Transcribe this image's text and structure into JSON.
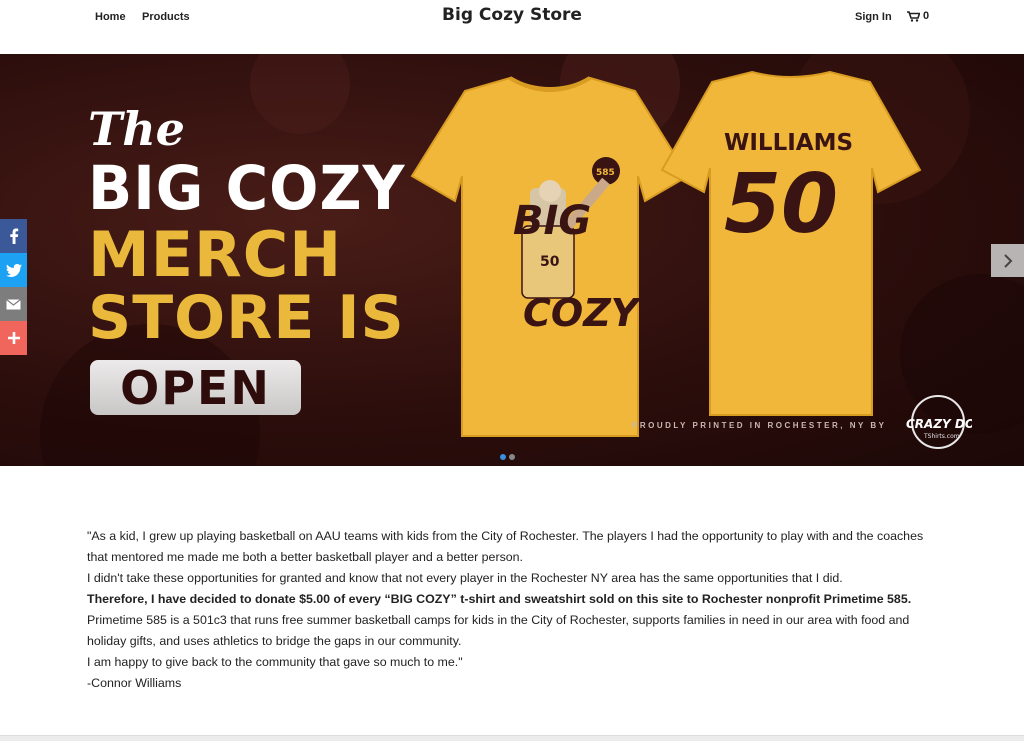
{
  "nav": {
    "home": "Home",
    "products": "Products",
    "site_title": "Big Cozy Store",
    "sign_in": "Sign In",
    "cart_count": "0"
  },
  "hero": {
    "the": "The",
    "line1": "BIG COZY",
    "line2": "MERCH",
    "line3": "STORE IS",
    "open": "OPEN",
    "shirt_front_big": "BIG",
    "shirt_front_cozy": "COZY",
    "shirt_front_num": "50",
    "shirt_front_ball": "585",
    "shirt_back_name": "WILLIAMS",
    "shirt_back_num": "50",
    "printed_note": "PROUDLY PRINTED IN ROCHESTER, NY BY",
    "logo_text": "CRAZY DOG",
    "logo_sub": "TShirts.com",
    "shirt_color": "#f1b73a",
    "shirt_ink": "#3a1313",
    "accent": "#eab93b"
  },
  "carousel": {
    "slides": 2,
    "active": 1
  },
  "share": [
    {
      "name": "facebook",
      "color": "#3b5998"
    },
    {
      "name": "twitter",
      "color": "#1da1f2"
    },
    {
      "name": "email",
      "color": "#7d7d7d"
    },
    {
      "name": "more",
      "color": "#f0665c"
    }
  ],
  "content": {
    "p1": "\"As a kid, I grew up playing basketball on AAU teams with kids from the City of Rochester. The players I had the opportunity to play with and the coaches that mentored me made me both a better basketball player and a better person.",
    "p2": "I didn't take these opportunities for granted and know that not every player in the Rochester NY area has the same opportunities that I did.",
    "p3": " Therefore, I have decided to donate $5.00 of every “BIG COZY” t-shirt and sweatshirt sold on this site to Rochester nonprofit Primetime 585.",
    "p4": "Primetime 585 is a 501c3 that runs free summer basketball camps for kids in the City of Rochester, supports families in need in our area with food and holiday gifts, and uses athletics to bridge the gaps in our community.",
    "p5": "I am happy to give back to the community that gave so much to me.\"",
    "signature": "-Connor Williams"
  }
}
